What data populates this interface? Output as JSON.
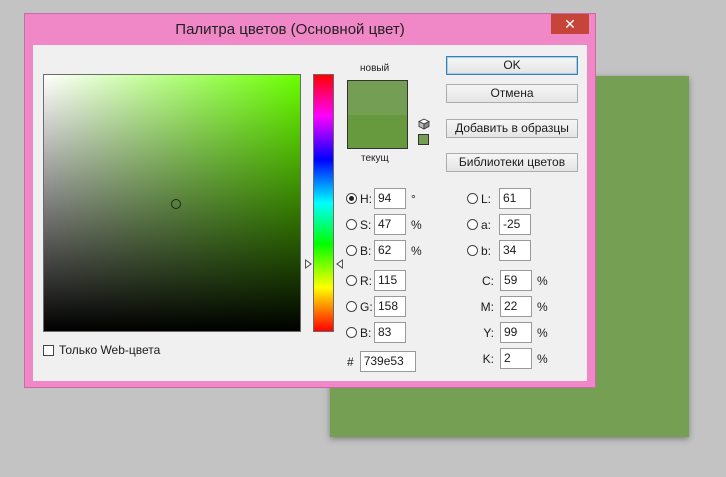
{
  "dialog": {
    "title": "Палитра цветов (Основной цвет)",
    "close_glyph": "✕"
  },
  "colors": {
    "new": "#739e53",
    "current": "#679a3e",
    "background_document": "#75a054"
  },
  "preview": {
    "new_label": "новый",
    "current_label": "текущ"
  },
  "buttons": {
    "ok": "OK",
    "cancel": "Отмена",
    "add_to_swatches": "Добавить в образцы",
    "color_libraries": "Библиотеки цветов"
  },
  "webonly": {
    "label": "Только Web-цвета",
    "checked": false
  },
  "hsb": {
    "h": {
      "label": "H:",
      "value": "94",
      "unit": "°",
      "selected": true
    },
    "s": {
      "label": "S:",
      "value": "47",
      "unit": "%"
    },
    "b": {
      "label": "B:",
      "value": "62",
      "unit": "%"
    }
  },
  "rgb": {
    "r": {
      "label": "R:",
      "value": "115"
    },
    "g": {
      "label": "G:",
      "value": "158"
    },
    "b": {
      "label": "B:",
      "value": "83"
    }
  },
  "lab": {
    "l": {
      "label": "L:",
      "value": "61"
    },
    "a": {
      "label": "a:",
      "value": "-25"
    },
    "b": {
      "label": "b:",
      "value": "34"
    }
  },
  "cmyk": {
    "c": {
      "label": "C:",
      "value": "59",
      "unit": "%"
    },
    "m": {
      "label": "M:",
      "value": "22",
      "unit": "%"
    },
    "y": {
      "label": "Y:",
      "value": "99",
      "unit": "%"
    },
    "k": {
      "label": "K:",
      "value": "2",
      "unit": "%"
    }
  },
  "hex": {
    "label": "#",
    "value": "739e53"
  }
}
